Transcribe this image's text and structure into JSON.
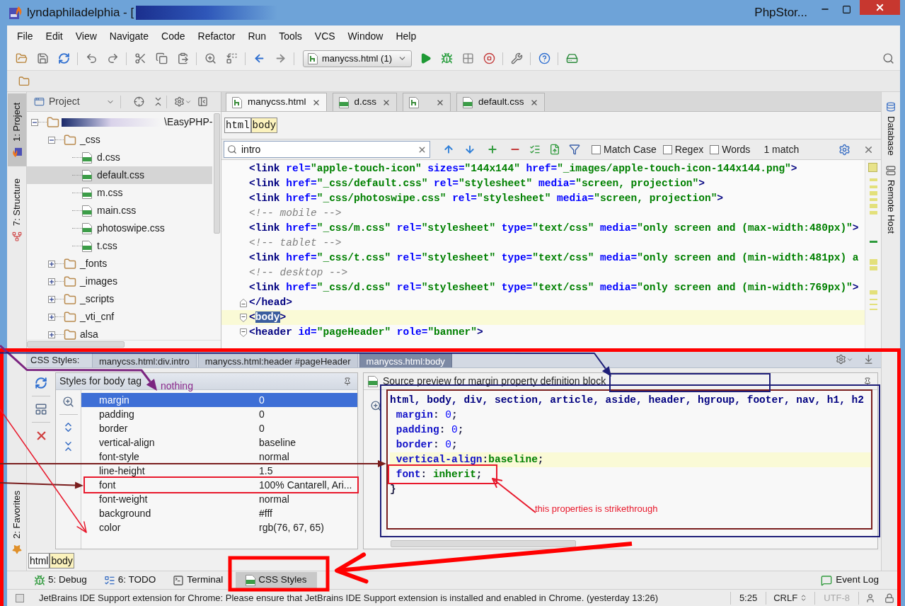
{
  "window": {
    "title": "lyndaphiladelphia - [",
    "app_name": "PhpStor..."
  },
  "menu": [
    "File",
    "Edit",
    "View",
    "Navigate",
    "Code",
    "Refactor",
    "Run",
    "Tools",
    "VCS",
    "Window",
    "Help"
  ],
  "toolbar": {
    "run_configuration": "manycss.html (1)"
  },
  "left_strip": {
    "top": [
      {
        "label": "1: Project",
        "kind": "project",
        "selected": true
      },
      {
        "label": "7: Structure",
        "kind": "structure",
        "selected": false
      }
    ],
    "bottom": [
      {
        "label": "2: Favorites",
        "kind": "favorites",
        "selected": false
      }
    ]
  },
  "right_strip": [
    {
      "label": "Database",
      "kind": "database"
    },
    {
      "label": "Remote Host",
      "kind": "remote"
    }
  ],
  "project": {
    "title": "Project",
    "tree": [
      {
        "label": "\\EasyPHP-",
        "kind": "folder",
        "redacted": true,
        "expanded": true,
        "selected": false,
        "children": [
          {
            "label": "_css",
            "kind": "folder",
            "expanded": true,
            "selected": false,
            "children": [
              {
                "label": "d.css",
                "kind": "css",
                "selected": false
              },
              {
                "label": "default.css",
                "kind": "css",
                "selected": true
              },
              {
                "label": "m.css",
                "kind": "css",
                "selected": false
              },
              {
                "label": "main.css",
                "kind": "css",
                "selected": false
              },
              {
                "label": "photoswipe.css",
                "kind": "css",
                "selected": false
              },
              {
                "label": "t.css",
                "kind": "css",
                "selected": false
              }
            ]
          },
          {
            "label": "_fonts",
            "kind": "folder",
            "expanded": false,
            "selected": false
          },
          {
            "label": "_images",
            "kind": "folder",
            "expanded": false,
            "selected": false
          },
          {
            "label": "_scripts",
            "kind": "folder",
            "expanded": false,
            "selected": false
          },
          {
            "label": "_vti_cnf",
            "kind": "folder",
            "expanded": false,
            "selected": false
          },
          {
            "label": "alsa",
            "kind": "folder",
            "expanded": false,
            "selected": false
          }
        ]
      }
    ]
  },
  "editor": {
    "tabs": [
      {
        "label": "manycss.html",
        "kind": "html",
        "selected": true
      },
      {
        "label": "d.css",
        "kind": "css",
        "selected": false
      },
      {
        "kind": "html",
        "selected": false
      },
      {
        "label": "default.css",
        "kind": "css",
        "selected": false
      }
    ],
    "breadcrumbs": [
      {
        "label": "html",
        "selected": false
      },
      {
        "label": "body",
        "selected": true
      }
    ],
    "search": {
      "value": "intro",
      "options": [
        {
          "label": "Match Case",
          "checked": false
        },
        {
          "label": "Regex",
          "checked": false
        },
        {
          "label": "Words",
          "checked": false
        }
      ],
      "result": "1 match"
    },
    "lines": [
      {
        "kind": "plain",
        "current": false,
        "tokens": [
          {
            "kind": "tag",
            "text": "<link"
          },
          {
            "kind": "attr",
            "text": " rel="
          },
          {
            "kind": "value",
            "text": "\"apple-touch-icon\""
          },
          {
            "kind": "attr",
            "text": " sizes="
          },
          {
            "kind": "value",
            "text": "\"144x144\""
          },
          {
            "kind": "attr",
            "text": " href="
          },
          {
            "kind": "value",
            "text": "\"_images/apple-touch-icon-144x144.png\""
          },
          {
            "kind": "tag",
            "text": ">"
          }
        ]
      },
      {
        "kind": "plain",
        "current": false,
        "tokens": [
          {
            "kind": "tag",
            "text": "<link"
          },
          {
            "kind": "attr",
            "text": " href="
          },
          {
            "kind": "value",
            "text": "\"_css/default.css\""
          },
          {
            "kind": "attr",
            "text": " rel="
          },
          {
            "kind": "value",
            "text": "\"stylesheet\""
          },
          {
            "kind": "attr",
            "text": " media="
          },
          {
            "kind": "value",
            "text": "\"screen, projection\""
          },
          {
            "kind": "tag",
            "text": ">"
          }
        ]
      },
      {
        "kind": "plain",
        "current": false,
        "tokens": [
          {
            "kind": "tag",
            "text": "<link"
          },
          {
            "kind": "attr",
            "text": " href="
          },
          {
            "kind": "value",
            "text": "\"_css/photoswipe.css\""
          },
          {
            "kind": "attr",
            "text": " rel="
          },
          {
            "kind": "value",
            "text": "\"stylesheet\""
          },
          {
            "kind": "attr",
            "text": " media="
          },
          {
            "kind": "value",
            "text": "\"screen, projection\""
          },
          {
            "kind": "tag",
            "text": ">"
          }
        ]
      },
      {
        "kind": "plain",
        "current": false,
        "tokens": [
          {
            "kind": "comment",
            "text": "<!-- mobile -->"
          }
        ]
      },
      {
        "kind": "plain",
        "current": false,
        "tokens": [
          {
            "kind": "tag",
            "text": "<link"
          },
          {
            "kind": "attr",
            "text": " href="
          },
          {
            "kind": "value",
            "text": "\"_css/m.css\""
          },
          {
            "kind": "attr",
            "text": " rel="
          },
          {
            "kind": "value",
            "text": "\"stylesheet\""
          },
          {
            "kind": "attr",
            "text": " type="
          },
          {
            "kind": "value",
            "text": "\"text/css\""
          },
          {
            "kind": "attr",
            "text": " media="
          },
          {
            "kind": "value",
            "text": "\"only screen and (max-width:480px)\""
          },
          {
            "kind": "tag",
            "text": ">"
          }
        ]
      },
      {
        "kind": "plain",
        "current": false,
        "tokens": [
          {
            "kind": "comment",
            "text": "<!-- tablet -->"
          }
        ]
      },
      {
        "kind": "plain",
        "current": false,
        "tokens": [
          {
            "kind": "tag",
            "text": "<link"
          },
          {
            "kind": "attr",
            "text": " href="
          },
          {
            "kind": "value",
            "text": "\"_css/t.css\""
          },
          {
            "kind": "attr",
            "text": " rel="
          },
          {
            "kind": "value",
            "text": "\"stylesheet\""
          },
          {
            "kind": "attr",
            "text": " type="
          },
          {
            "kind": "value",
            "text": "\"text/css\""
          },
          {
            "kind": "attr",
            "text": " media="
          },
          {
            "kind": "value",
            "text": "\"only screen and (min-width:481px) a"
          }
        ]
      },
      {
        "kind": "plain",
        "current": false,
        "tokens": [
          {
            "kind": "comment",
            "text": "<!-- desktop -->"
          }
        ]
      },
      {
        "kind": "plain",
        "current": false,
        "tokens": [
          {
            "kind": "tag",
            "text": "<link"
          },
          {
            "kind": "attr",
            "text": " href="
          },
          {
            "kind": "value",
            "text": "\"_css/d.css\""
          },
          {
            "kind": "attr",
            "text": " rel="
          },
          {
            "kind": "value",
            "text": "\"stylesheet\""
          },
          {
            "kind": "attr",
            "text": " type="
          },
          {
            "kind": "value",
            "text": "\"text/css\""
          },
          {
            "kind": "attr",
            "text": " media="
          },
          {
            "kind": "value",
            "text": "\"only screen and (min-width:769px)\""
          },
          {
            "kind": "tag",
            "text": ">"
          }
        ]
      },
      {
        "kind": "fold_end",
        "current": false,
        "tokens": [
          {
            "kind": "tag",
            "text": "</head>"
          }
        ]
      },
      {
        "kind": "fold_start",
        "current": true,
        "tokens": [
          {
            "kind": "tag",
            "text": "<"
          },
          {
            "kind": "selected_tag",
            "text": "body"
          },
          {
            "kind": "tag",
            "text": ">"
          }
        ]
      },
      {
        "kind": "fold_start",
        "current": false,
        "tokens": [
          {
            "kind": "tag",
            "text": "<header"
          },
          {
            "kind": "attr",
            "text": " id="
          },
          {
            "kind": "value",
            "text": "\"pageHeader\""
          },
          {
            "kind": "attr",
            "text": " role="
          },
          {
            "kind": "value",
            "text": "\"banner\""
          },
          {
            "kind": "tag",
            "text": ">"
          }
        ]
      }
    ]
  },
  "css_styles": {
    "label": "CSS Styles:",
    "tabs": [
      {
        "label": "manycss.html:div.intro",
        "selected": false
      },
      {
        "label": "manycss.html:header #pageHeader",
        "selected": false
      },
      {
        "label": "manycss.html:body",
        "selected": true
      }
    ],
    "styles": {
      "title": "Styles for body tag",
      "rows": [
        {
          "property": "margin",
          "value": "0",
          "selected": true
        },
        {
          "property": "padding",
          "value": "0",
          "selected": false
        },
        {
          "property": "border",
          "value": "0",
          "selected": false
        },
        {
          "property": "vertical-align",
          "value": "baseline",
          "selected": false
        },
        {
          "property": "font-style",
          "value": "normal",
          "selected": false
        },
        {
          "property": "line-height",
          "value": "1.5",
          "selected": false
        },
        {
          "property": "font",
          "value": "100% Cantarell, Ari...",
          "selected": false
        },
        {
          "property": "font-weight",
          "value": "normal",
          "selected": false
        },
        {
          "property": "background",
          "value": "#fff",
          "selected": false
        },
        {
          "property": "color",
          "value": "rgb(76, 67, 65)",
          "selected": false
        }
      ]
    },
    "preview": {
      "title": "Source preview for margin property definition block",
      "lines": [
        {
          "current": false,
          "tokens": [
            {
              "kind": "selector",
              "text": "html, body, div, section, article, aside, header, hgroup, footer, nav, h1, h2"
            }
          ]
        },
        {
          "current": false,
          "tokens": [
            {
              "kind": "property",
              "text": " margin"
            },
            {
              "kind": "plain",
              "text": ": "
            },
            {
              "kind": "number",
              "text": "0"
            },
            {
              "kind": "plain",
              "text": ";"
            }
          ]
        },
        {
          "current": false,
          "tokens": [
            {
              "kind": "property",
              "text": " padding"
            },
            {
              "kind": "plain",
              "text": ": "
            },
            {
              "kind": "number",
              "text": "0"
            },
            {
              "kind": "plain",
              "text": ";"
            }
          ]
        },
        {
          "current": false,
          "tokens": [
            {
              "kind": "property",
              "text": " border"
            },
            {
              "kind": "plain",
              "text": ": "
            },
            {
              "kind": "number",
              "text": "0"
            },
            {
              "kind": "plain",
              "text": ";"
            }
          ]
        },
        {
          "current": true,
          "tokens": [
            {
              "kind": "property",
              "text": " vertical-align"
            },
            {
              "kind": "plain",
              "text": ":"
            },
            {
              "kind": "value",
              "text": "baseline"
            },
            {
              "kind": "plain",
              "text": ";"
            }
          ]
        },
        {
          "current": false,
          "tokens": [
            {
              "kind": "property",
              "text": " font"
            },
            {
              "kind": "plain",
              "text": ": "
            },
            {
              "kind": "value",
              "text": "inherit"
            },
            {
              "kind": "plain",
              "text": ";"
            }
          ]
        },
        {
          "current": false,
          "tokens": [
            {
              "kind": "plain",
              "text": "}"
            }
          ]
        }
      ]
    },
    "breadcrumbs": [
      {
        "label": "html",
        "selected": false
      },
      {
        "label": "body",
        "selected": true
      }
    ]
  },
  "tool_windows": [
    {
      "label": "5: Debug",
      "kind": "debug",
      "selected": false
    },
    {
      "label": "6: TODO",
      "kind": "todo",
      "selected": false
    },
    {
      "label": "Terminal",
      "kind": "terminal",
      "selected": false
    },
    {
      "label": "CSS Styles",
      "kind": "css",
      "selected": true
    }
  ],
  "event_log": "Event Log",
  "status_bar": {
    "message": "JetBrains IDE Support extension for Chrome: Please ensure that JetBrains IDE Support extension is installed and enabled in Chrome. (yesterday 13:26)",
    "position": "5:25",
    "line_separator": "CRLF",
    "encoding": {
      "label": "UTF-8",
      "disabled": true
    }
  },
  "annotations": [
    {
      "text": "nothing",
      "color": "#8b2a8d"
    },
    {
      "text": "this properties is strikethrough",
      "color": "#e8192c"
    }
  ]
}
